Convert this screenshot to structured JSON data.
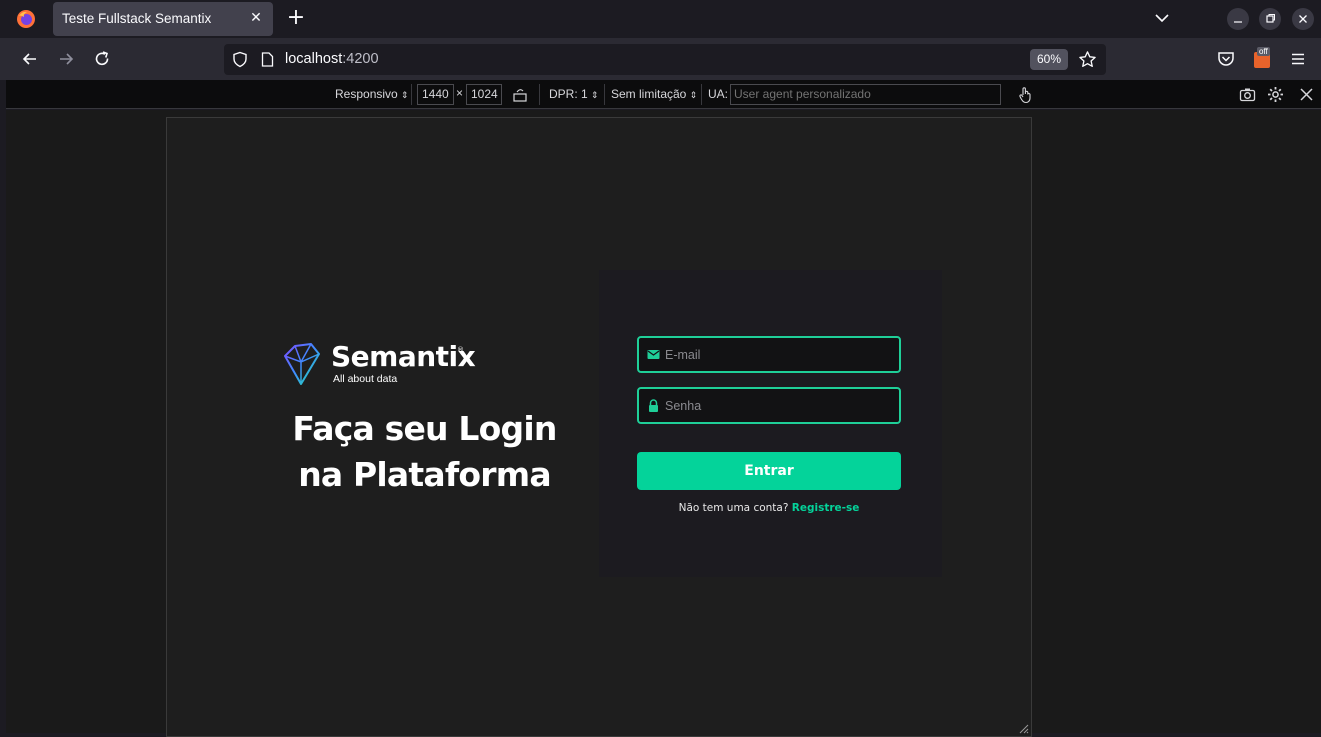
{
  "browser": {
    "tab_title": "Teste Fullstack Semantix",
    "url_host": "localhost",
    "url_port": ":4200",
    "zoom": "60%",
    "extension_badge": "off"
  },
  "rdm": {
    "device": "Responsivo",
    "width": "1440",
    "height": "1024",
    "times": "×",
    "dpr": "DPR: 1",
    "throttle": "Sem limitação",
    "ua_label": "UA:",
    "ua_placeholder": "User agent personalizado"
  },
  "page": {
    "brand_name": "Semantix",
    "brand_reg": "®",
    "brand_tagline": "All about data",
    "headline_line1": "Faça seu Login",
    "headline_line2": "na Plataforma",
    "email_placeholder": "E-mail",
    "password_placeholder": "Senha",
    "submit_label": "Entrar",
    "signup_prompt": "Não tem uma conta?",
    "signup_link": "Registre-se"
  },
  "colors": {
    "accent": "#04d39a",
    "field_border": "#1fcf98",
    "card_bg": "#1c1b20",
    "page_bg": "#1e1e1e"
  },
  "icons": {
    "email": "mail-icon",
    "password": "lock-icon"
  }
}
